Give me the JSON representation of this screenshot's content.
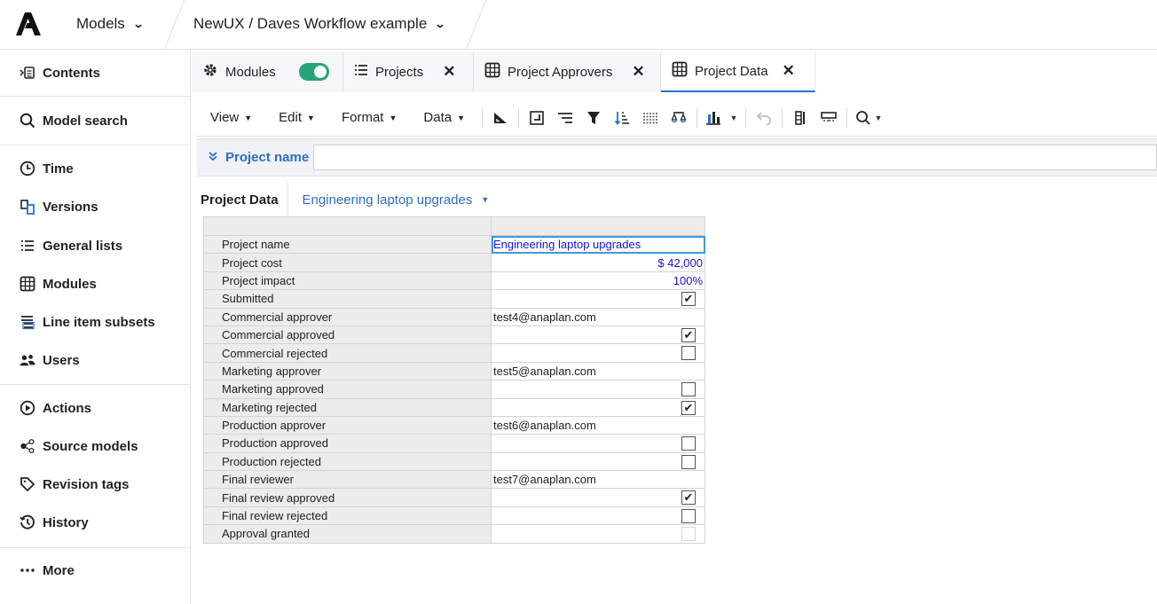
{
  "topbar": {
    "models_label": "Models",
    "path_label": "NewUX / Daves Workflow example"
  },
  "sidebar": {
    "items": [
      {
        "label": "Contents",
        "icon": "contents-icon"
      },
      {
        "label": "Model search",
        "icon": "search-icon"
      },
      {
        "label": "Time",
        "icon": "clock-icon"
      },
      {
        "label": "Versions",
        "icon": "versions-icon"
      },
      {
        "label": "General lists",
        "icon": "list-icon"
      },
      {
        "label": "Modules",
        "icon": "grid-icon"
      },
      {
        "label": "Line item subsets",
        "icon": "subset-icon"
      },
      {
        "label": "Users",
        "icon": "users-icon"
      },
      {
        "label": "Actions",
        "icon": "play-icon"
      },
      {
        "label": "Source models",
        "icon": "share-icon"
      },
      {
        "label": "Revision tags",
        "icon": "tag-icon"
      },
      {
        "label": "History",
        "icon": "history-icon"
      },
      {
        "label": "More",
        "icon": "more-icon"
      }
    ]
  },
  "tabs": [
    {
      "label": "Modules"
    },
    {
      "label": "Projects"
    },
    {
      "label": "Project Approvers"
    },
    {
      "label": "Project Data"
    }
  ],
  "toolbar": {
    "view": "View",
    "edit": "Edit",
    "format": "Format",
    "data": "Data"
  },
  "filter": {
    "label": "Project name",
    "value": ""
  },
  "page_selector": {
    "title": "Project Data",
    "selected": "Engineering laptop upgrades"
  },
  "grid": {
    "rows": [
      {
        "label": "Project name",
        "type": "text",
        "value": "Engineering laptop upgrades",
        "selected": true
      },
      {
        "label": "Project cost",
        "type": "number",
        "value": "$ 42,000"
      },
      {
        "label": "Project impact",
        "type": "number",
        "value": "100%"
      },
      {
        "label": "Submitted",
        "type": "check",
        "checked": true
      },
      {
        "label": "Commercial approver",
        "type": "text",
        "value": "test4@anaplan.com"
      },
      {
        "label": "Commercial approved",
        "type": "check",
        "checked": true
      },
      {
        "label": "Commercial rejected",
        "type": "check",
        "checked": false
      },
      {
        "label": "Marketing approver",
        "type": "text",
        "value": "test5@anaplan.com"
      },
      {
        "label": "Marketing approved",
        "type": "check",
        "checked": false
      },
      {
        "label": "Marketing rejected",
        "type": "check",
        "checked": true
      },
      {
        "label": "Production approver",
        "type": "text",
        "value": "test6@anaplan.com"
      },
      {
        "label": "Production approved",
        "type": "check",
        "checked": false
      },
      {
        "label": "Production rejected",
        "type": "check",
        "checked": false
      },
      {
        "label": "Final reviewer",
        "type": "text",
        "value": "test7@anaplan.com"
      },
      {
        "label": "Final review approved",
        "type": "check",
        "checked": true
      },
      {
        "label": "Final review rejected",
        "type": "check",
        "checked": false
      },
      {
        "label": "Approval granted",
        "type": "check",
        "checked": false,
        "readonly": true
      }
    ]
  }
}
